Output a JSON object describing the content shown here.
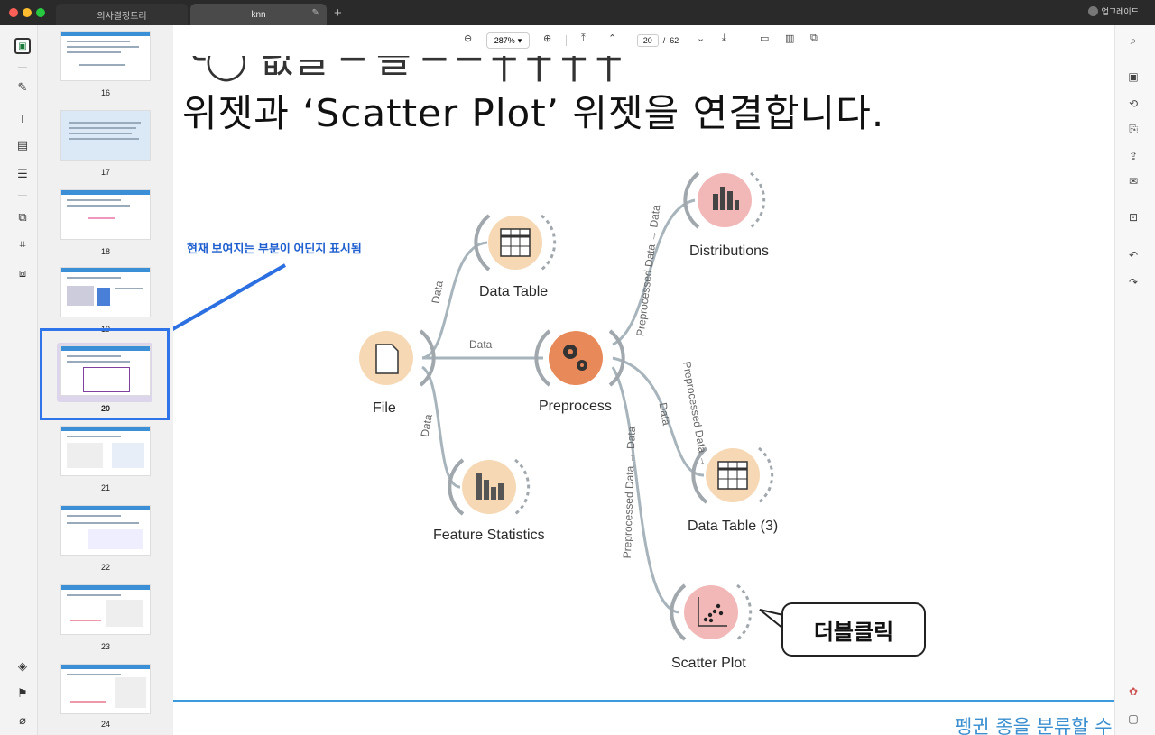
{
  "window": {
    "tabs": [
      {
        "label": "의사결정트리"
      },
      {
        "label": "knn"
      }
    ],
    "upgrade_label": "업그레이드"
  },
  "toolbar": {
    "zoom": "287%",
    "page_current": "20",
    "page_separator": "/",
    "page_total": "62"
  },
  "thumbnails": [
    {
      "num": "16"
    },
    {
      "num": "17"
    },
    {
      "num": "18"
    },
    {
      "num": "19"
    },
    {
      "num": "20"
    },
    {
      "num": "21"
    },
    {
      "num": "22"
    },
    {
      "num": "23"
    },
    {
      "num": "24"
    }
  ],
  "annotation": {
    "text": "현재 보여지는 부분이 어딘지 표시됨"
  },
  "document": {
    "heading": "위젯과 ‘Scatter Plot’ 위젯을 연결합니다.",
    "footer": "펭귄 종을 분류할 수",
    "callout": "더블클릭"
  },
  "workflow": {
    "nodes": {
      "file": "File",
      "data_table": "Data Table",
      "feature_statistics": "Feature Statistics",
      "preprocess": "Preprocess",
      "distributions": "Distributions",
      "data_table_3": "Data Table (3)",
      "scatter_plot": "Scatter Plot"
    },
    "edges": {
      "file_to_data_table": "Data",
      "file_to_preprocess": "Data",
      "file_to_feature_stats": "Data",
      "pre_to_distributions": "Preprocessed Data → Data",
      "pre_to_datatable3_a": "Preprocessed Data →",
      "pre_to_datatable3_b": "Data",
      "pre_to_scatter": "Preprocessed Data → Data"
    },
    "colors": {
      "data_node": "#f6d8b4",
      "preprocess_node": "#e8895a",
      "vis_node": "#f2b8b8",
      "edge": "#a7b4bb",
      "arc": "#a0a7ad"
    }
  }
}
